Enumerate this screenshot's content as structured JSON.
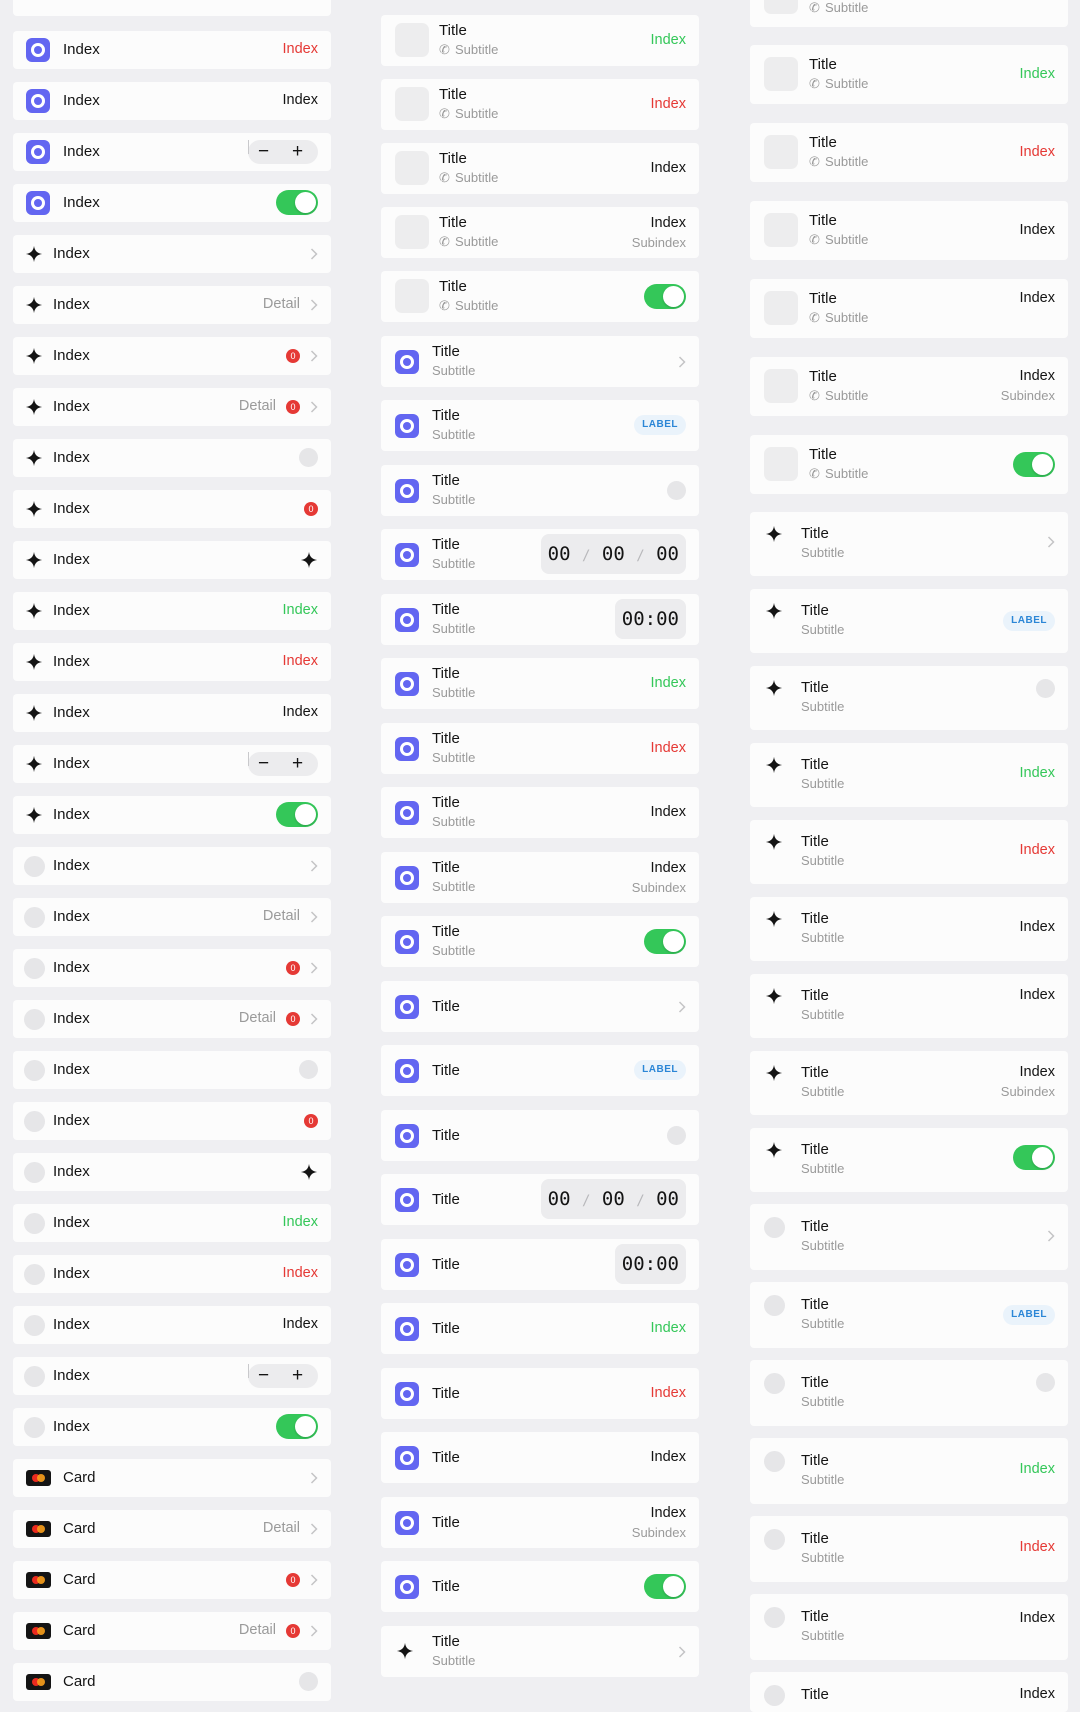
{
  "col1": {
    "row1_label": "Index",
    "row1_value": "Index",
    "row2_label": "Index",
    "row2_value": "Index",
    "row3_label": "Index",
    "row3_value": "Index",
    "row4_label": "Index",
    "row5_label": "Index",
    "row6_label": "Index",
    "row7_label": "Index",
    "row7_detail": "Detail",
    "row8_label": "Index",
    "row8_badge": "0",
    "row9_label": "Index",
    "row9_detail": "Detail",
    "row9_badge": "0",
    "row10_label": "Index",
    "row11_label": "Index",
    "row11_badge": "0",
    "row12_label": "Index",
    "row13_label": "Index",
    "row13_value": "Index",
    "row14_label": "Index",
    "row14_value": "Index",
    "row15_label": "Index",
    "row15_value": "Index",
    "row16_label": "Index",
    "row17_label": "Index",
    "row18_label": "Index",
    "row19_label": "Index",
    "row19_detail": "Detail",
    "row20_label": "Index",
    "row20_badge": "0",
    "row21_label": "Index",
    "row21_detail": "Detail",
    "row21_badge": "0",
    "row22_label": "Index",
    "row23_label": "Index",
    "row23_badge": "0",
    "row24_label": "Index",
    "row25_label": "Index",
    "row25_value": "Index",
    "row26_label": "Index",
    "row26_value": "Index",
    "row27_label": "Index",
    "row27_value": "Index",
    "row28_label": "Index",
    "row29_label": "Index",
    "row30_label": "Card",
    "row31_label": "Card",
    "row31_detail": "Detail",
    "row32_label": "Card",
    "row32_badge": "0",
    "row33_label": "Card",
    "row33_detail": "Detail",
    "row33_badge": "0",
    "row34_label": "Card"
  },
  "col2": {
    "r1_title": "Title",
    "r1_subtitle": "Subtitle",
    "r1_value": "Index",
    "r2_title": "Title",
    "r2_subtitle": "Subtitle",
    "r2_value": "Index",
    "r3_title": "Title",
    "r3_subtitle": "Subtitle",
    "r3_value": "Index",
    "r4_title": "Title",
    "r4_subtitle": "Subtitle",
    "r4_value": "Index",
    "r4_subvalue": "Subindex",
    "r5_title": "Title",
    "r5_subtitle": "Subtitle",
    "r6_title": "Title",
    "r6_subtitle": "Subtitle",
    "r7_title": "Title",
    "r7_subtitle": "Subtitle",
    "r7_label": "LABEL",
    "r8_title": "Title",
    "r8_subtitle": "Subtitle",
    "r9_title": "Title",
    "r9_subtitle": "Subtitle",
    "r9_h": "00",
    "r9_m": "00",
    "r9_s": "00",
    "r10_title": "Title",
    "r10_subtitle": "Subtitle",
    "r10_timer": "00:00",
    "r11_title": "Title",
    "r11_subtitle": "Subtitle",
    "r11_value": "Index",
    "r12_title": "Title",
    "r12_subtitle": "Subtitle",
    "r12_value": "Index",
    "r13_title": "Title",
    "r13_subtitle": "Subtitle",
    "r13_value": "Index",
    "r14_title": "Title",
    "r14_subtitle": "Subtitle",
    "r14_value": "Index",
    "r14_subvalue": "Subindex",
    "r15_title": "Title",
    "r15_subtitle": "Subtitle",
    "r16_title": "Title",
    "r17_title": "Title",
    "r17_label": "LABEL",
    "r18_title": "Title",
    "r19_title": "Title",
    "r19_h": "00",
    "r19_m": "00",
    "r19_s": "00",
    "r20_title": "Title",
    "r20_timer": "00:00",
    "r21_title": "Title",
    "r21_value": "Index",
    "r22_title": "Title",
    "r22_value": "Index",
    "r23_title": "Title",
    "r23_value": "Index",
    "r24_title": "Title",
    "r24_value": "Index",
    "r24_subvalue": "Subindex",
    "r25_title": "Title",
    "r26_title": "Title",
    "r26_subtitle": "Subtitle"
  },
  "col3": {
    "r1_subtitle": "Subtitle",
    "r2_title": "Title",
    "r2_subtitle": "Subtitle",
    "r2_value": "Index",
    "r3_title": "Title",
    "r3_subtitle": "Subtitle",
    "r3_value": "Index",
    "r4_title": "Title",
    "r4_subtitle": "Subtitle",
    "r4_value": "Index",
    "r5_title": "Title",
    "r5_subtitle": "Subtitle",
    "r5_value": "Index",
    "r6_title": "Title",
    "r6_subtitle": "Subtitle",
    "r6_value": "Index",
    "r6_subvalue": "Subindex",
    "r7_title": "Title",
    "r7_subtitle": "Subtitle",
    "r8_title": "Title",
    "r8_subtitle": "Subtitle",
    "r9_title": "Title",
    "r9_subtitle": "Subtitle",
    "r9_label": "LABEL",
    "r10_title": "Title",
    "r10_subtitle": "Subtitle",
    "r11_title": "Title",
    "r11_subtitle": "Subtitle",
    "r11_value": "Index",
    "r12_title": "Title",
    "r12_subtitle": "Subtitle",
    "r12_value": "Index",
    "r13_title": "Title",
    "r13_subtitle": "Subtitle",
    "r13_value": "Index",
    "r14_title": "Title",
    "r14_subtitle": "Subtitle",
    "r14_value": "Index",
    "r15_title": "Title",
    "r15_subtitle": "Subtitle",
    "r15_value": "Index",
    "r15_subvalue": "Subindex",
    "r16_title": "Title",
    "r16_subtitle": "Subtitle",
    "r17_title": "Title",
    "r17_subtitle": "Subtitle",
    "r18_title": "Title",
    "r18_subtitle": "Subtitle",
    "r18_label": "LABEL",
    "r19_title": "Title",
    "r19_subtitle": "Subtitle",
    "r20_title": "Title",
    "r20_subtitle": "Subtitle",
    "r20_value": "Index",
    "r21_title": "Title",
    "r21_subtitle": "Subtitle",
    "r21_value": "Index",
    "r22_title": "Title",
    "r22_subtitle": "Subtitle",
    "r22_value": "Index",
    "r23_title": "Title",
    "r23_value": "Index"
  },
  "colors": {
    "accent": "#6366f1",
    "green": "#34c759",
    "red": "#e53935",
    "label_blue": "#2b86d6"
  },
  "icons": [
    "rounded-square-icon",
    "sparkle-icon",
    "circle-placeholder-icon",
    "credit-card-icon",
    "phone-icon",
    "chevron-right-icon"
  ]
}
